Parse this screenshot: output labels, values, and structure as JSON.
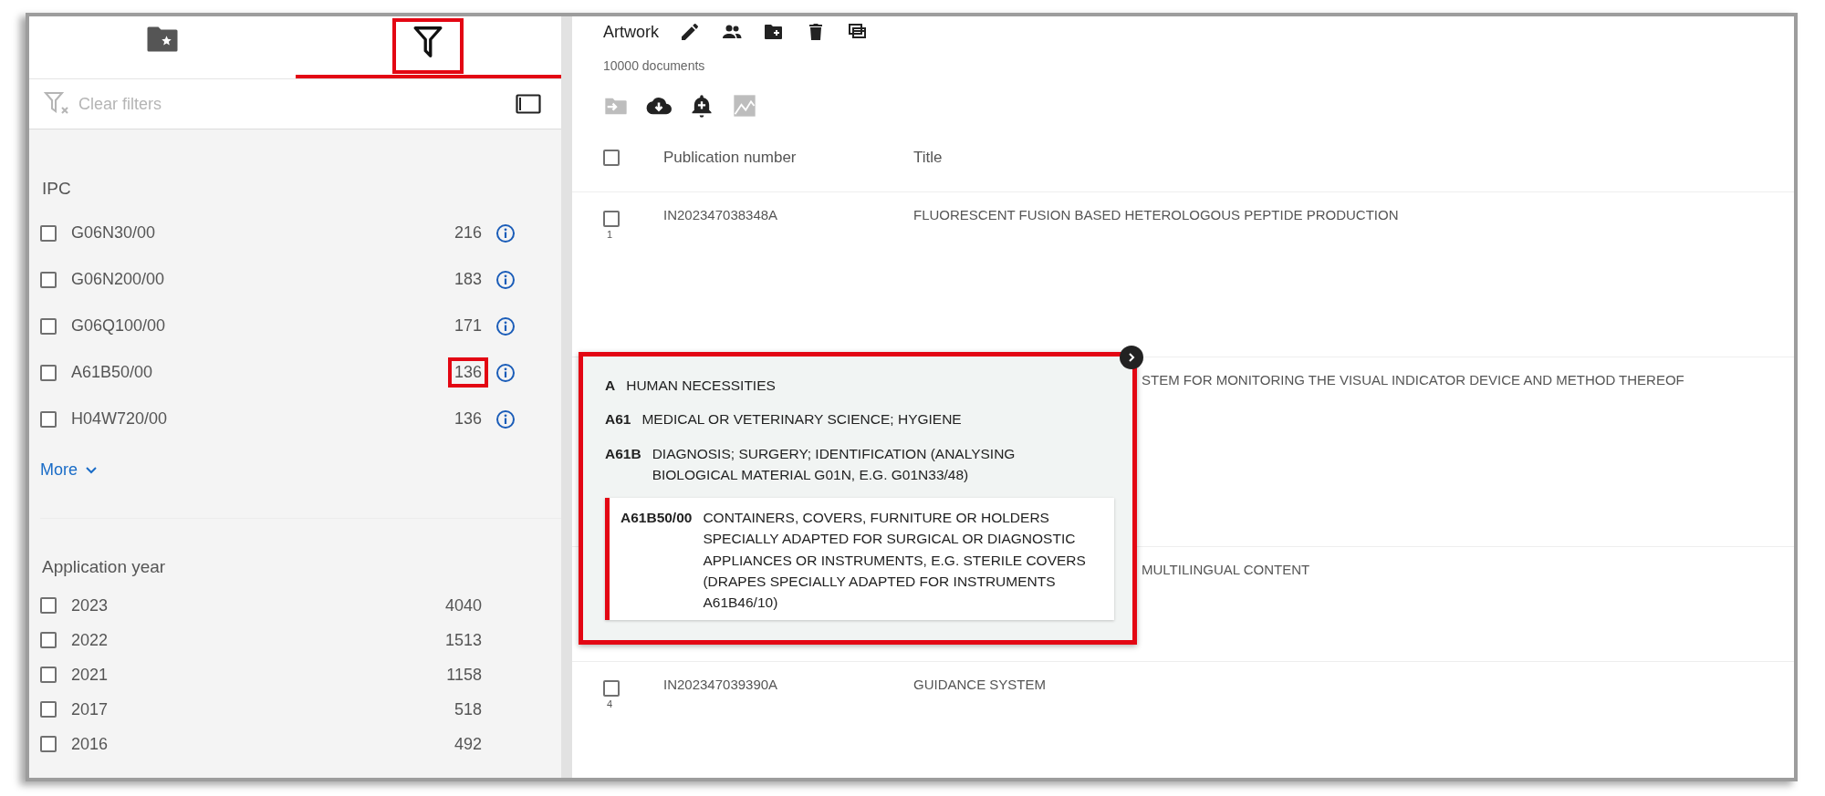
{
  "sidebar": {
    "tabs": [
      {
        "selected": false,
        "highlighted": false
      },
      {
        "selected": true,
        "highlighted": true
      }
    ],
    "clear_filters": {
      "label": "Clear filters",
      "disabled": true
    },
    "facets": [
      {
        "title": "IPC",
        "more": "More",
        "items": [
          {
            "label": "G06N30/00",
            "count": "216",
            "checked": false,
            "info": true,
            "highlighted": false
          },
          {
            "label": "G06N200/00",
            "count": "183",
            "checked": false,
            "info": true,
            "highlighted": false
          },
          {
            "label": "G06Q100/00",
            "count": "171",
            "checked": false,
            "info": true,
            "highlighted": false
          },
          {
            "label": "A61B50/00",
            "count": "136",
            "checked": false,
            "info": true,
            "highlighted": true
          },
          {
            "label": "H04W720/00",
            "count": "136",
            "checked": false,
            "info": true,
            "highlighted": false
          }
        ]
      },
      {
        "title": "Application year",
        "items": [
          {
            "label": "2023",
            "count": "4040",
            "checked": false,
            "info": false,
            "highlighted": false
          },
          {
            "label": "2022",
            "count": "1513",
            "checked": false,
            "info": false,
            "highlighted": false
          },
          {
            "label": "2021",
            "count": "1158",
            "checked": false,
            "info": false,
            "highlighted": false
          },
          {
            "label": "2017",
            "count": "518",
            "checked": false,
            "info": false,
            "highlighted": false
          },
          {
            "label": "2016",
            "count": "492",
            "checked": false,
            "info": false,
            "highlighted": false
          }
        ]
      }
    ]
  },
  "main": {
    "title": "Artwork",
    "count": "10000 documents",
    "toolbar": [
      {
        "disabled": true
      },
      {
        "disabled": false
      },
      {
        "disabled": false
      },
      {
        "disabled": true
      }
    ],
    "table": {
      "columns": [
        "Publication number",
        "Title"
      ],
      "all_checked": false,
      "rows": [
        {
          "kind": "full",
          "index": "1",
          "number": "IN202347038348A",
          "title": "FLUORESCENT FUSION BASED HETEROLOGOUS PEPTIDE PRODUCTION",
          "checked": false
        },
        {
          "kind": "covered",
          "title": "STEM FOR MONITORING THE VISUAL INDICATOR DEVICE AND METHOD THEREOF"
        },
        {
          "kind": "covered",
          "title": "MULTILINGUAL CONTENT"
        },
        {
          "kind": "full",
          "index": "4",
          "number": "IN202347039390A",
          "title": "GUIDANCE SYSTEM",
          "checked": false
        }
      ]
    }
  },
  "tooltip": {
    "highlighted": true,
    "entries": [
      {
        "code": "A",
        "text": "HUMAN NECESSITIES",
        "selected": false
      },
      {
        "code": "A61",
        "text": "MEDICAL OR VETERINARY SCIENCE; HYGIENE",
        "selected": false
      },
      {
        "code": "A61B",
        "text": "DIAGNOSIS; SURGERY; IDENTIFICATION (ANALYSING BIOLOGICAL MATERIAL G01N, E.G. G01N33/48)",
        "selected": false
      },
      {
        "code": "A61B50/00",
        "text": "CONTAINERS, COVERS, FURNITURE OR HOLDERS SPECIALLY ADAPTED FOR SURGICAL OR DIAGNOSTIC APPLIANCES OR INSTRUMENTS, E.G. STERILE COVERS (DRAPES SPECIALLY ADAPTED FOR INSTRUMENTS A61B46/10)",
        "selected": true
      }
    ]
  }
}
